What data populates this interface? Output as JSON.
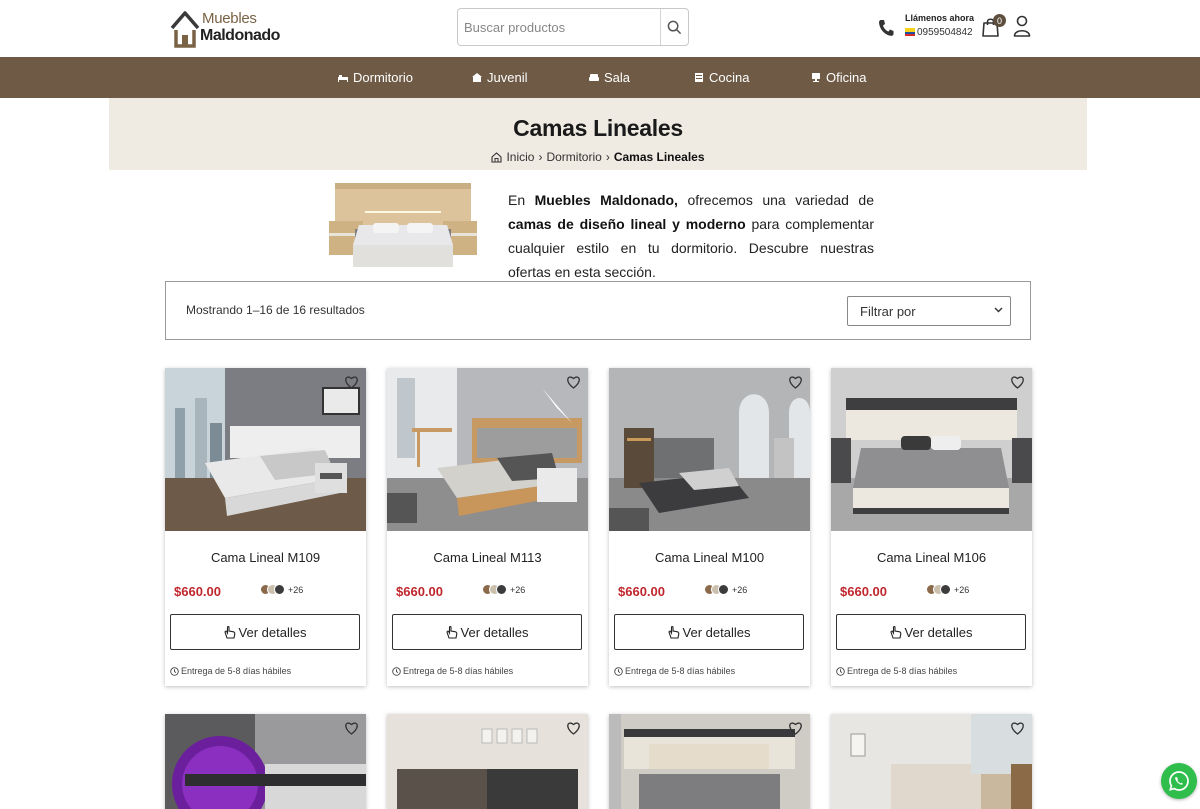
{
  "header": {
    "logo": {
      "line1": "Muebles",
      "line2": "Maldonado"
    },
    "search": {
      "placeholder": "Buscar productos"
    },
    "call": {
      "label": "Llámenos ahora",
      "phone": "0959504842"
    },
    "cart_count": "0"
  },
  "nav": {
    "items": [
      {
        "label": "Dormitorio",
        "icon": "bed-icon"
      },
      {
        "label": "Juvenil",
        "icon": "teen-icon"
      },
      {
        "label": "Sala",
        "icon": "sofa-icon"
      },
      {
        "label": "Cocina",
        "icon": "kitchen-icon"
      },
      {
        "label": "Oficina",
        "icon": "office-icon"
      }
    ]
  },
  "banner": {
    "title": "Camas Lineales",
    "breadcrumb": [
      "Inicio",
      "Dormitorio",
      "Camas Lineales"
    ]
  },
  "intro": {
    "p1": "En ",
    "b1": "Muebles Maldonado,",
    "p2": " ofrecemos una variedad de ",
    "b2": "camas de diseño lineal y moderno",
    "p3": " para complementar cualquier estilo en tu dormitorio. Descubre nuestras ofertas en esta sección."
  },
  "results": {
    "count_text": "Mostrando 1–16 de 16 resultados",
    "filter_label": "Filtrar por"
  },
  "products": [
    {
      "name": "Cama Lineal M109",
      "price": "$660.00",
      "more_colors": "+26",
      "button": "Ver detalles",
      "delivery": "Entrega de 5-8 días hábiles"
    },
    {
      "name": "Cama Lineal M113",
      "price": "$660.00",
      "more_colors": "+26",
      "button": "Ver detalles",
      "delivery": "Entrega de 5-8 días hábiles"
    },
    {
      "name": "Cama Lineal M100",
      "price": "$660.00",
      "more_colors": "+26",
      "button": "Ver detalles",
      "delivery": "Entrega de 5-8 días hábiles"
    },
    {
      "name": "Cama Lineal M106",
      "price": "$660.00",
      "more_colors": "+26",
      "button": "Ver detalles",
      "delivery": "Entrega de 5-8 días hábiles"
    }
  ],
  "colors": {
    "brand_brown": "#6f5a45",
    "banner_bg": "#efeae2",
    "price_red": "#c0272d",
    "whatsapp_green": "#2fbe4b",
    "swatches": [
      "#8a6a4a",
      "#cbbfae",
      "#3c3c3c"
    ]
  }
}
